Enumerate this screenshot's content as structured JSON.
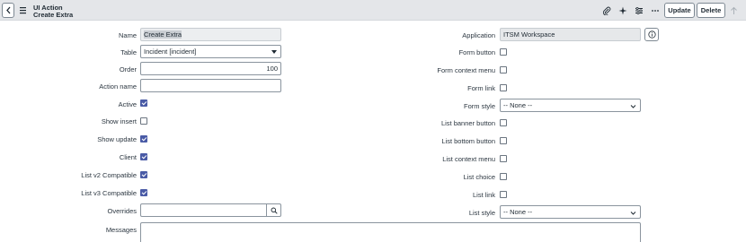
{
  "header": {
    "title_line1": "UI Action",
    "title_line2": "Create Extra",
    "update_label": "Update",
    "delete_label": "Delete"
  },
  "left": {
    "name": {
      "label": "Name",
      "value": "Create Extra"
    },
    "table": {
      "label": "Table",
      "value": "Incident [incident]"
    },
    "order": {
      "label": "Order",
      "value": "100"
    },
    "action_name": {
      "label": "Action name",
      "value": ""
    },
    "active": {
      "label": "Active",
      "checked": true
    },
    "show_insert": {
      "label": "Show insert",
      "checked": false
    },
    "show_update": {
      "label": "Show update",
      "checked": true
    },
    "client": {
      "label": "Client",
      "checked": true
    },
    "list_v2": {
      "label": "List v2 Compatible",
      "checked": true
    },
    "list_v3": {
      "label": "List v3 Compatible",
      "checked": true
    },
    "overrides": {
      "label": "Overrides",
      "value": ""
    },
    "messages": {
      "label": "Messages",
      "value": ""
    }
  },
  "right": {
    "application": {
      "label": "Application",
      "value": "ITSM Workspace"
    },
    "form_button": {
      "label": "Form button",
      "checked": false
    },
    "form_context_menu": {
      "label": "Form context menu",
      "checked": false
    },
    "form_link": {
      "label": "Form link",
      "checked": false
    },
    "form_style": {
      "label": "Form style",
      "value": "-- None --"
    },
    "list_banner_button": {
      "label": "List banner button",
      "checked": false
    },
    "list_bottom_button": {
      "label": "List bottom button",
      "checked": false
    },
    "list_context_menu": {
      "label": "List context menu",
      "checked": false
    },
    "list_choice": {
      "label": "List choice",
      "checked": false
    },
    "list_link": {
      "label": "List link",
      "checked": false
    },
    "list_style": {
      "label": "List style",
      "value": "-- None --"
    }
  },
  "icons": {
    "back": "chevron-left-icon",
    "menu": "hamburger-menu-icon",
    "attach": "paperclip-icon",
    "activity": "sparkle-icon",
    "settings": "sliders-icon",
    "more": "more-options-icon",
    "up": "arrow-up-icon",
    "search": "search-icon",
    "info": "info-icon"
  },
  "colors": {
    "header_bg": "#e4e6e9",
    "checkbox_on": "#4a5ba6",
    "readonly_bg": "#e6e8ea"
  }
}
